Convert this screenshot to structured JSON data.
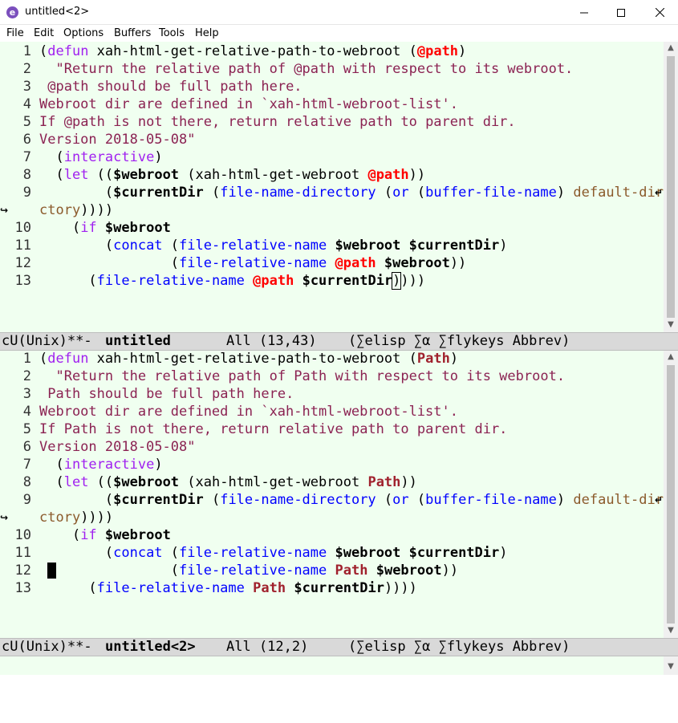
{
  "window": {
    "title": "untitled<2>",
    "app_icon": "emacs-icon",
    "controls": {
      "minimize": "minimize-icon",
      "maximize": "maximize-icon",
      "close": "close-icon"
    }
  },
  "menu": {
    "items": [
      "File",
      "Edit",
      "Options",
      "Buffers",
      "Tools",
      "Help"
    ]
  },
  "panes": [
    {
      "param": "@path",
      "buffer_name": "untitled",
      "modeline": {
        "status": "cU(Unix)**-",
        "buffer": "untitled",
        "position": "All (13,43)",
        "modes": "(∑elisp ∑α ∑flykeys Abbrev)"
      }
    },
    {
      "param": "Path",
      "buffer_name": "untitled<2>",
      "modeline": {
        "status": "cU(Unix)**-",
        "buffer": "untitled<2>",
        "position": "All (12,2)",
        "modes": "(∑elisp ∑α ∑flykeys Abbrev)"
      }
    }
  ],
  "code": {
    "line_numbers": [
      "1",
      "2",
      "3",
      "4",
      "5",
      "6",
      "7",
      "8",
      "9",
      "",
      "10",
      "11",
      "12",
      "13"
    ],
    "defun": "defun",
    "fn_name": " xah-html-get-relative-path-to-webroot ",
    "doc1_a": "\"Return the relative path of ",
    "doc1_b": " with respect to its webroot.",
    "doc2_b": " should be full path here.",
    "doc3": "Webroot dir are defined in `xah-html-webroot-list'.",
    "doc4_a": "If ",
    "doc4_b": " is not there, return relative path to parent dir.",
    "doc5": "Version 2018-05-08\"",
    "interactive": "interactive",
    "let": "let",
    "webroot_var": "$webroot",
    "get_webroot": " (xah-html-get-webroot ",
    "currentdir_var": "$currentDir",
    "file_name_directory": "file-name-directory",
    "or": "or",
    "buffer_file_name": "buffer-file-name",
    "default_dire": "default-dire",
    "ctory": "ctory",
    "if": "if",
    "concat": "concat",
    "file_relative_name": "file-relative-name"
  }
}
